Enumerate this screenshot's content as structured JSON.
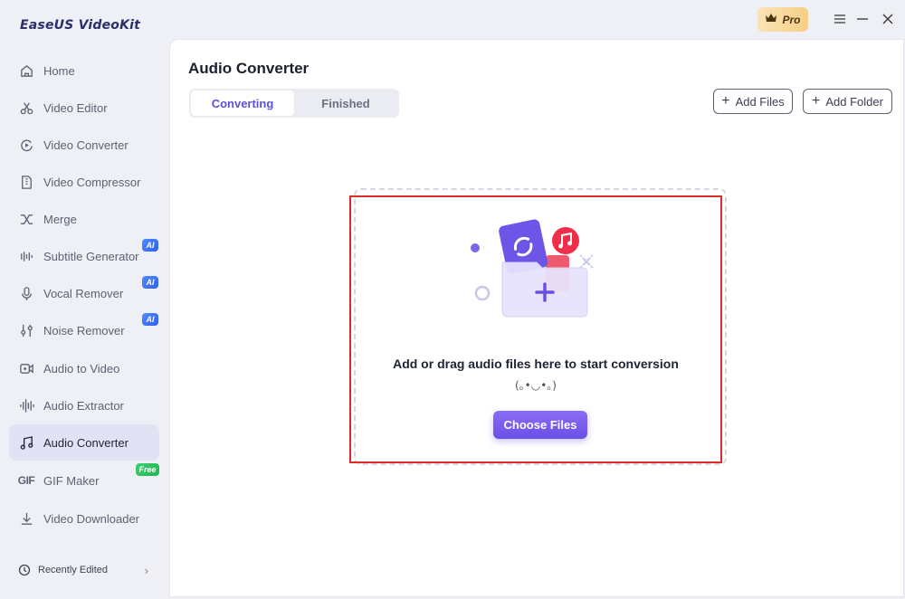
{
  "app": {
    "logo": "EaseUS VideoKit",
    "pro_label": "Pro"
  },
  "window_controls": {
    "menu_icon": "hamburger-icon",
    "minimize_icon": "minimize-icon",
    "close_icon": "close-icon"
  },
  "sidebar": {
    "items": [
      {
        "label": "Home",
        "icon": "home-icon"
      },
      {
        "label": "Video Editor",
        "icon": "scissors-icon"
      },
      {
        "label": "Video Converter",
        "icon": "convert-icon"
      },
      {
        "label": "Video Compressor",
        "icon": "compress-icon"
      },
      {
        "label": "Merge",
        "icon": "merge-icon"
      },
      {
        "label": "Subtitle Generator",
        "icon": "subtitle-icon",
        "badge": "AI"
      },
      {
        "label": "Vocal Remover",
        "icon": "microphone-icon",
        "badge": "AI"
      },
      {
        "label": "Noise Remover",
        "icon": "sliders-icon",
        "badge": "AI"
      },
      {
        "label": "Audio to Video",
        "icon": "video-camera-icon"
      },
      {
        "label": "Audio Extractor",
        "icon": "waveform-icon"
      },
      {
        "label": "Audio Converter",
        "icon": "music-note-icon",
        "active": true
      },
      {
        "label": "GIF Maker",
        "icon": "gif-icon",
        "badge": "Free",
        "glyph": "GIF"
      },
      {
        "label": "Video Downloader",
        "icon": "download-icon"
      }
    ],
    "recent_label": "Recently Edited"
  },
  "main": {
    "title": "Audio Converter",
    "tabs": [
      {
        "label": "Converting",
        "active": true
      },
      {
        "label": "Finished",
        "active": false
      }
    ],
    "add_files_label": "Add Files",
    "add_folder_label": "Add Folder",
    "drop_text": "Add or drag audio files here to start conversion",
    "kaomoji": "(｡•◡•｡)",
    "choose_button_label": "Choose Files"
  },
  "colors": {
    "accent": "#6a4fe6",
    "highlight_border": "#e02a2a",
    "active_nav_bg": "#e3e2f4",
    "music_badge": "#ef2f4a"
  }
}
